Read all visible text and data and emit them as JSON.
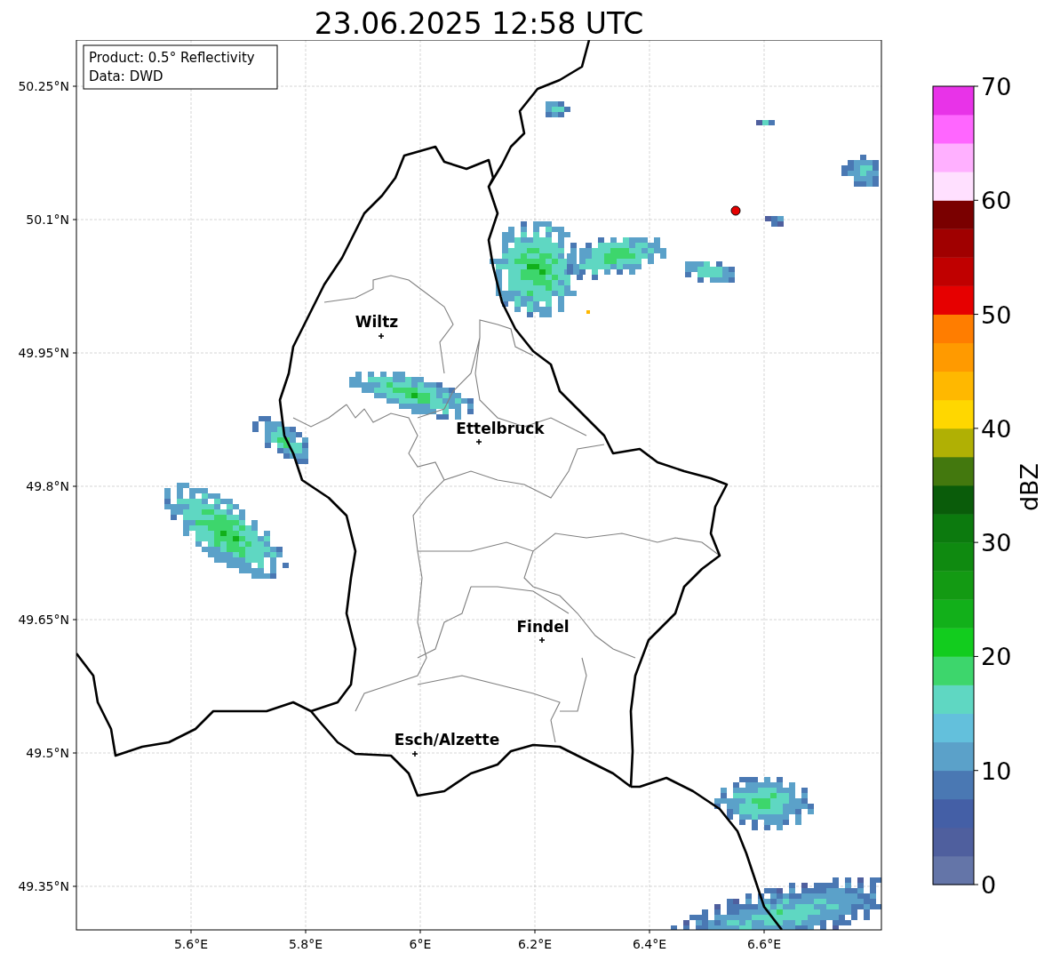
{
  "title": "23.06.2025 12:58 UTC",
  "info_box": {
    "lines": [
      "Product: 0.5° Reflectivity",
      "Data: DWD"
    ]
  },
  "map": {
    "x_ticks": [
      "5.6°E",
      "5.8°E",
      "6°E",
      "6.2°E",
      "6.4°E",
      "6.6°E"
    ],
    "y_ticks": [
      "50.25°N",
      "50.1°N",
      "49.95°N",
      "49.8°N",
      "49.65°N",
      "49.5°N",
      "49.35°N"
    ],
    "cities": [
      {
        "name": "Wiltz"
      },
      {
        "name": "Ettelbruck"
      },
      {
        "name": "Findel"
      },
      {
        "name": "Esch/Alzette"
      }
    ]
  },
  "colorbar": {
    "label": "dBZ",
    "ticks": [
      "70",
      "60",
      "50",
      "40",
      "30",
      "20",
      "10",
      "0"
    ],
    "segments": [
      {
        "color": "#6475a8"
      },
      {
        "color": "#4f5f9e"
      },
      {
        "color": "#445fa6"
      },
      {
        "color": "#4a78b3"
      },
      {
        "color": "#5ba1c9"
      },
      {
        "color": "#63c0dc"
      },
      {
        "color": "#5fd7c2"
      },
      {
        "color": "#3dd66c"
      },
      {
        "color": "#12cc1e"
      },
      {
        "color": "#12b01a"
      },
      {
        "color": "#139a13"
      },
      {
        "color": "#0f8a10"
      },
      {
        "color": "#0c7a0e"
      },
      {
        "color": "#0a5c0a"
      },
      {
        "color": "#43780e"
      },
      {
        "color": "#b0b004"
      },
      {
        "color": "#ffd700"
      },
      {
        "color": "#ffb800"
      },
      {
        "color": "#ff9a00"
      },
      {
        "color": "#ff7d00"
      },
      {
        "color": "#e60000"
      },
      {
        "color": "#c00000"
      },
      {
        "color": "#a00000"
      },
      {
        "color": "#7a0000"
      },
      {
        "color": "#ffe0ff"
      },
      {
        "color": "#ffb0ff"
      },
      {
        "color": "#ff66ff"
      },
      {
        "color": "#e833e8"
      }
    ]
  }
}
